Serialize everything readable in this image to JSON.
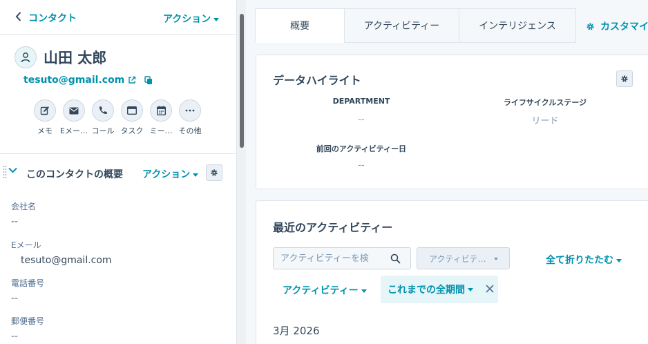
{
  "sidebar": {
    "back_label": "コンタクト",
    "top_action": "アクション",
    "contact": {
      "name": "山田 太郎",
      "email": "tesuto@gmail.com"
    },
    "actions": [
      {
        "label": "メモ",
        "icon": "note-edit-icon"
      },
      {
        "label": "Eメー…",
        "icon": "email-icon"
      },
      {
        "label": "コール",
        "icon": "phone-icon"
      },
      {
        "label": "タスク",
        "icon": "task-icon"
      },
      {
        "label": "ミー…",
        "icon": "calendar-icon"
      },
      {
        "label": "その他",
        "icon": "more-icon"
      }
    ],
    "section": {
      "title": "このコンタクトの概要",
      "action": "アクション"
    },
    "properties": [
      {
        "label": "会社名",
        "value": "--"
      },
      {
        "label": "Eメール",
        "value": "tesuto@gmail.com"
      },
      {
        "label": "電話番号",
        "value": "--"
      },
      {
        "label": "郵便番号",
        "value": "--"
      }
    ]
  },
  "tabs": [
    {
      "label": "概要",
      "active": true
    },
    {
      "label": "アクティビティー",
      "active": false
    },
    {
      "label": "インテリジェンス",
      "active": false
    }
  ],
  "customize_label": "カスタマイ",
  "highlights": {
    "title": "データハイライト",
    "items": [
      {
        "label": "DEPARTMENT",
        "value": "--"
      },
      {
        "label": "ライフサイクルステージ",
        "value": "リード"
      },
      {
        "label": "前回のアクティビティー日",
        "value": "--"
      }
    ]
  },
  "recent": {
    "title": "最近のアクティビティー",
    "search_placeholder": "アクティビティーを検",
    "filter_select": "アクティビテ…",
    "collapse_all": "全て折りたたむ",
    "filter_activity": "アクティビティー",
    "filter_period": "これまでの全期間",
    "month": "3月 2026"
  },
  "colors": {
    "accent": "#0091ae",
    "text": "#33475b",
    "muted": "#516f90",
    "border": "#dfe3eb",
    "background": "#f5f8fa",
    "pill": "#e5f5f8"
  }
}
